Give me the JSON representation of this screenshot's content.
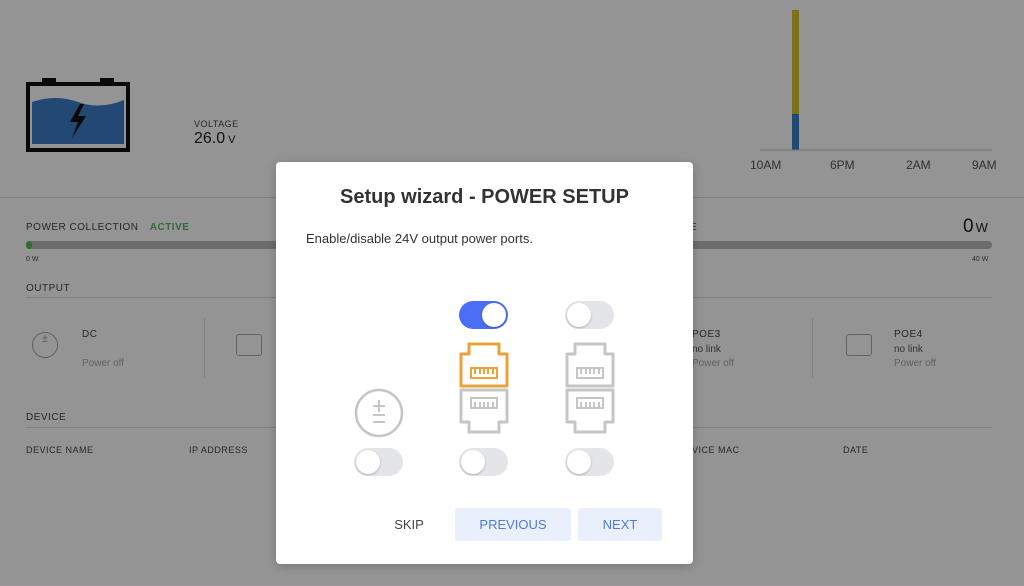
{
  "battery": {
    "voltage_label": "VOLTAGE",
    "voltage_value": "26.0",
    "voltage_unit": "V"
  },
  "chart": {
    "x_labels": [
      "10AM",
      "6PM",
      "2AM",
      "9AM"
    ]
  },
  "power_collection": {
    "label": "POWER COLLECTION",
    "status": "ACTIVE",
    "min": "0 W"
  },
  "power_right": {
    "label_tail": "E",
    "value": "0",
    "unit": "W",
    "max": "40 W"
  },
  "output": {
    "title": "OUTPUT",
    "ports": [
      {
        "name": "DC",
        "line1": "",
        "line2": "Power off"
      },
      {
        "name": "POE3",
        "line1": "no link",
        "line2": "Power off"
      },
      {
        "name": "POE4",
        "line1": "no link",
        "line2": "Power off"
      }
    ]
  },
  "device": {
    "title": "DEVICE",
    "columns": [
      "DEVICE NAME",
      "IP ADDRESS",
      "VICE MAC",
      "DATE"
    ]
  },
  "modal": {
    "title": "Setup wizard - POWER SETUP",
    "description": "Enable/disable 24V output power ports.",
    "skip": "SKIP",
    "previous": "PREVIOUS",
    "next": "NEXT"
  },
  "colors": {
    "accent": "#4c6ef5",
    "active": "#5cb85c",
    "port_active": "#e8a33a",
    "port_idle": "#c5c5c5"
  }
}
